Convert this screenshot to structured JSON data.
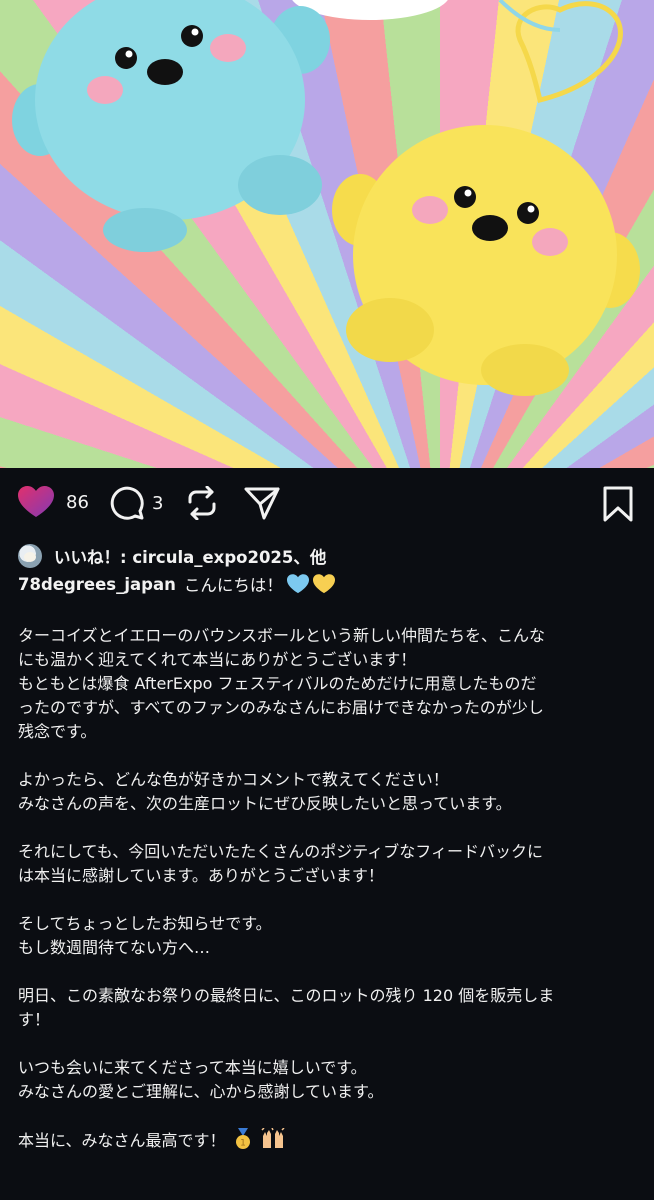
{
  "post": {
    "like_count": "86",
    "comment_count": "3",
    "likes_text": "いいね！: circula_expo2025、他"
  },
  "caption": {
    "username": "78degrees_japan",
    "greeting": "こんにちは！",
    "paragraphs": [
      [
        "ターコイズとイエローのバウンスボールという新しい仲間たちを、こんな",
        "にも温かく迎えてくれて本当にありがとうございます！",
        "もともとは爆食 AfterExpo フェスティバルのためだけに用意したものだ",
        "ったのですが、すべてのファンのみなさんにお届けできなかったのが少し",
        "残念です。"
      ],
      [
        "よかったら、どんな色が好きかコメントで教えてください！",
        "みなさんの声を、次の生産ロットにぜひ反映したいと思っています。"
      ],
      [
        "それにしても、今回いただいたたくさんのポジティブなフィードバックに",
        "は本当に感謝しています。ありがとうございます！"
      ],
      [
        "そしてちょっとしたお知らせです。",
        "もし数週間待てない方へ…"
      ],
      [
        "明日、この素敵なお祭りの最終日に、このロットの残り 120 個を販売しま",
        "す！"
      ],
      [
        "いつも会いに来てくださって本当に嬉しいです。",
        "みなさんの愛とご理解に、心から感謝しています。"
      ]
    ],
    "closing": "本当に、みなさん最高です！"
  },
  "icons": {
    "like": "heart-filled-icon",
    "comment": "comment-bubble-icon",
    "repost": "repost-icon",
    "share": "send-icon",
    "save": "bookmark-icon"
  },
  "colors": {
    "background": "#0b0d12",
    "like_gradient_start": "#e1306c",
    "like_gradient_end": "#833ab4",
    "text": "#f2f2f2"
  }
}
